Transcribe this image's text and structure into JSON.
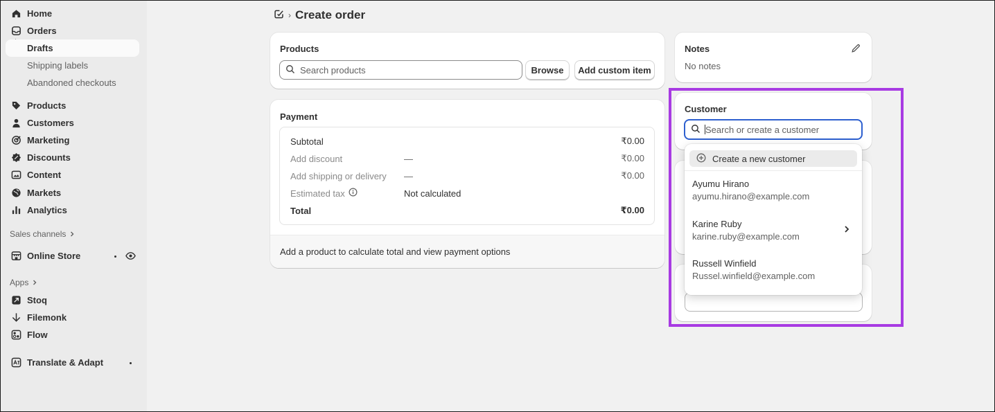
{
  "sidebar": {
    "nav": [
      {
        "label": "Home",
        "icon": "home-icon"
      },
      {
        "label": "Orders",
        "icon": "orders-icon"
      }
    ],
    "orders_sub": [
      {
        "label": "Drafts",
        "active": true
      },
      {
        "label": "Shipping labels",
        "active": false
      },
      {
        "label": "Abandoned checkouts",
        "active": false
      }
    ],
    "main_nav": [
      {
        "label": "Products",
        "icon": "tag-icon"
      },
      {
        "label": "Customers",
        "icon": "person-icon"
      },
      {
        "label": "Marketing",
        "icon": "target-icon"
      },
      {
        "label": "Discounts",
        "icon": "discount-icon"
      },
      {
        "label": "Content",
        "icon": "content-icon"
      },
      {
        "label": "Markets",
        "icon": "globe-icon"
      },
      {
        "label": "Analytics",
        "icon": "bar-chart-icon"
      }
    ],
    "sales_channels_label": "Sales channels",
    "online_store_label": "Online Store",
    "apps_label": "Apps",
    "apps": [
      {
        "label": "Stoq",
        "icon": "stoq-icon"
      },
      {
        "label": "Filemonk",
        "icon": "download-arrow-icon"
      },
      {
        "label": "Flow",
        "icon": "flow-icon"
      }
    ],
    "translate_label": "Translate & Adapt"
  },
  "header": {
    "title": "Create order"
  },
  "products": {
    "title": "Products",
    "search_placeholder": "Search products",
    "browse_label": "Browse",
    "add_custom_label": "Add custom item"
  },
  "payment": {
    "title": "Payment",
    "rows": {
      "subtotal": {
        "label": "Subtotal",
        "middle": "",
        "amount": "₹0.00"
      },
      "discount": {
        "label": "Add discount",
        "middle": "—",
        "amount": "₹0.00"
      },
      "shipping": {
        "label": "Add shipping or delivery",
        "middle": "—",
        "amount": "₹0.00"
      },
      "tax": {
        "label": "Estimated tax",
        "middle": "Not calculated",
        "amount": ""
      },
      "total": {
        "label": "Total",
        "middle": "",
        "amount": "₹0.00"
      }
    },
    "footer": "Add a product to calculate total and view payment options"
  },
  "notes": {
    "title": "Notes",
    "value": "No notes"
  },
  "customer": {
    "title": "Customer",
    "search_placeholder": "Search or create a customer",
    "create_label": "Create a new customer",
    "results": [
      {
        "name": "Ayumu Hirano",
        "email": "ayumu.hirano@example.com"
      },
      {
        "name": "Karine Ruby",
        "email": "karine.ruby@example.com"
      },
      {
        "name": "Russell Winfield",
        "email": "Russel.winfield@example.com"
      }
    ]
  },
  "colors": {
    "highlight": "#a83be3",
    "focus": "#2d5fcf"
  }
}
